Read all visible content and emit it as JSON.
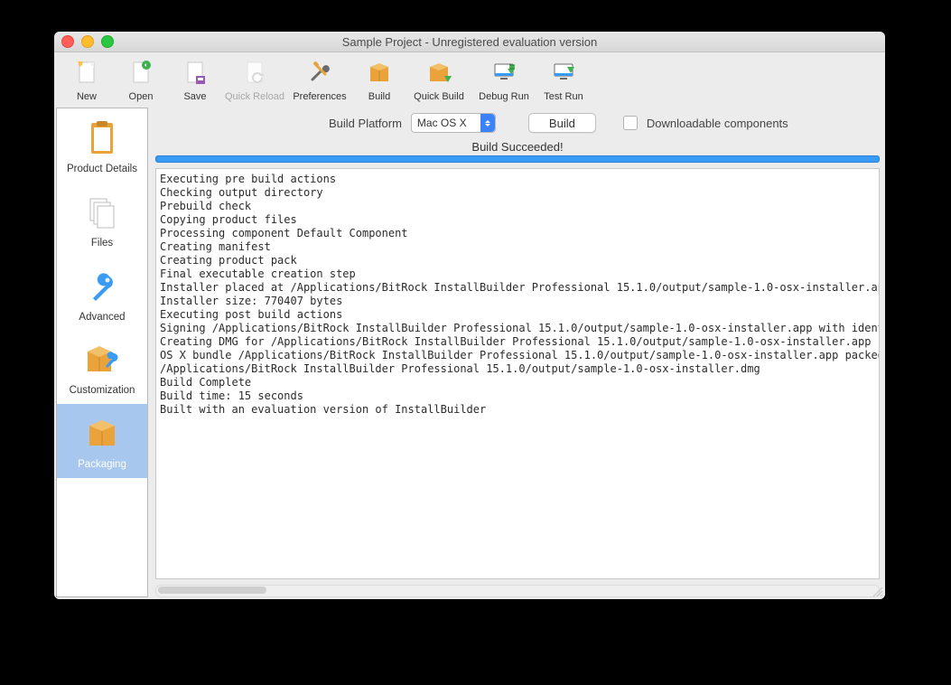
{
  "window": {
    "title": "Sample Project - Unregistered evaluation version"
  },
  "toolbar": {
    "new": "New",
    "open": "Open",
    "save": "Save",
    "quick_reload": "Quick Reload",
    "preferences": "Preferences",
    "build": "Build",
    "quick_build": "Quick Build",
    "debug_run": "Debug Run",
    "test_run": "Test Run"
  },
  "sidebar": {
    "product_details": "Product Details",
    "files": "Files",
    "advanced": "Advanced",
    "customization": "Customization",
    "packaging": "Packaging"
  },
  "buildbar": {
    "platform_label": "Build Platform",
    "platform_value": "Mac OS X",
    "build_button": "Build",
    "downloadable_label": "Downloadable components"
  },
  "status": {
    "message": "Build Succeeded!"
  },
  "log_lines": [
    "Executing pre build actions",
    "Checking output directory",
    "Prebuild check",
    "Copying product files",
    "Processing component Default Component",
    "Creating manifest",
    "Creating product pack",
    "Final executable creation step",
    "Installer placed at /Applications/BitRock InstallBuilder Professional 15.1.0/output/sample-1.0-osx-installer.app",
    "Installer size: 770407 bytes",
    "Executing post build actions",
    "Signing /Applications/BitRock InstallBuilder Professional 15.1.0/output/sample-1.0-osx-installer.app with identity",
    "Creating DMG for /Applications/BitRock InstallBuilder Professional 15.1.0/output/sample-1.0-osx-installer.app",
    "OS X bundle /Applications/BitRock InstallBuilder Professional 15.1.0/output/sample-1.0-osx-installer.app packed as",
    "/Applications/BitRock InstallBuilder Professional 15.1.0/output/sample-1.0-osx-installer.dmg",
    "Build Complete",
    "Build time: 15 seconds",
    "Built with an evaluation version of InstallBuilder"
  ],
  "colors": {
    "accent_orange": "#e9a33a",
    "accent_blue": "#3a9bf4",
    "accent_green": "#3fb24f"
  }
}
